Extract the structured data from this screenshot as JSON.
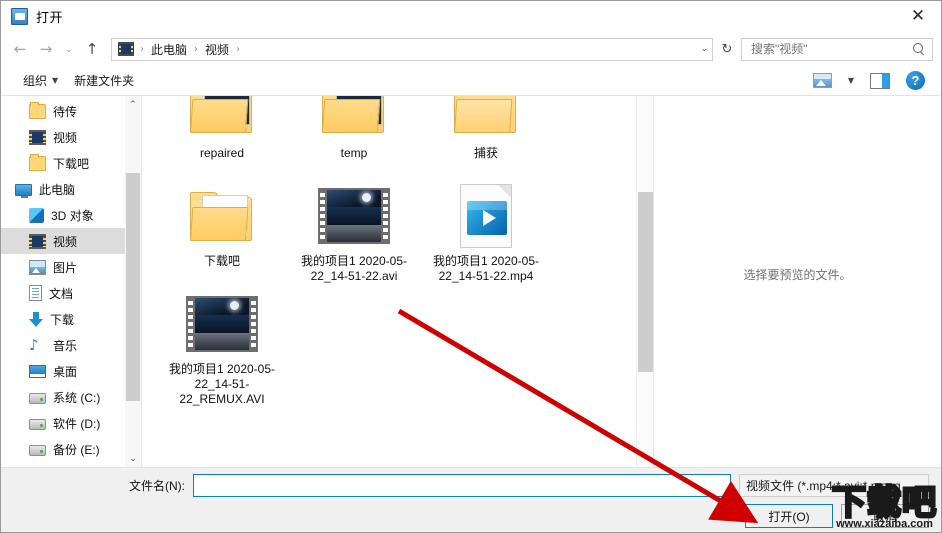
{
  "window": {
    "title": "打开",
    "close_label": "✕"
  },
  "nav": {
    "back": "←",
    "forward": "→",
    "recent": "⌄",
    "up": "↑",
    "refresh": "↻",
    "breadcrumb": [
      "此电脑",
      "视频"
    ],
    "separator": "›",
    "dropdown_caret": "⌄"
  },
  "search": {
    "placeholder": "搜索\"视频\"",
    "value": "",
    "icon": "search-icon"
  },
  "toolbar": {
    "organize_label": "组织",
    "organize_caret": "▼",
    "new_folder_label": "新建文件夹",
    "view_caret": "▼",
    "help_label": "?"
  },
  "sidebar": {
    "items": [
      {
        "label": "待传",
        "icon": "folder-icon",
        "indent": "child",
        "selected": false
      },
      {
        "label": "视频",
        "icon": "video-folder-icon",
        "indent": "child",
        "selected": false
      },
      {
        "label": "下载吧",
        "icon": "folder-icon",
        "indent": "child",
        "selected": false
      },
      {
        "label": "此电脑",
        "icon": "this-pc-icon",
        "indent": "root",
        "selected": false
      },
      {
        "label": "3D 对象",
        "icon": "3d-objects-icon",
        "indent": "child",
        "selected": false
      },
      {
        "label": "视频",
        "icon": "video-folder-icon",
        "indent": "child",
        "selected": true
      },
      {
        "label": "图片",
        "icon": "pictures-icon",
        "indent": "child",
        "selected": false
      },
      {
        "label": "文档",
        "icon": "documents-icon",
        "indent": "child",
        "selected": false
      },
      {
        "label": "下载",
        "icon": "downloads-icon",
        "indent": "child",
        "selected": false
      },
      {
        "label": "音乐",
        "icon": "music-icon",
        "indent": "child",
        "selected": false
      },
      {
        "label": "桌面",
        "icon": "desktop-icon",
        "indent": "child",
        "selected": false
      },
      {
        "label": "系统 (C:)",
        "icon": "drive-icon",
        "indent": "child",
        "selected": false
      },
      {
        "label": "软件 (D:)",
        "icon": "drive-icon",
        "indent": "child",
        "selected": false
      },
      {
        "label": "备份 (E:)",
        "icon": "drive-icon",
        "indent": "child",
        "selected": false
      }
    ],
    "scroll_up": "⌃",
    "scroll_down": "⌄"
  },
  "files": [
    {
      "name": "repaired",
      "type": "folder-with-preview"
    },
    {
      "name": "temp",
      "type": "folder-with-video-preview"
    },
    {
      "name": "捕获",
      "type": "folder-empty"
    },
    {
      "name": "下载吧",
      "type": "folder-with-disc"
    },
    {
      "name": "我的项目1 2020-05-22_14-51-22.avi",
      "type": "avi-film"
    },
    {
      "name": "我的项目1 2020-05-22_14-51-22.mp4",
      "type": "mp4-document"
    },
    {
      "name": "我的项目1 2020-05-22_14-51-22_REMUX.AVI",
      "type": "avi-film"
    }
  ],
  "preview": {
    "message": "选择要预览的文件。"
  },
  "footer": {
    "filename_label": "文件名(N):",
    "filename_value": "",
    "filter_value": "视频文件 (*.mp4;*.avi;*.mpeg",
    "filter_caret": "⌄",
    "open_label": "打开(O)",
    "cancel_label": "取消"
  },
  "watermark": {
    "main": "下载吧",
    "sub": "www.xiazaiba.com"
  },
  "colors": {
    "accent": "#0c7cc4",
    "selection": "#dcdcdc",
    "arrow": "#d00000",
    "footer_bg": "#f0f0f0"
  }
}
